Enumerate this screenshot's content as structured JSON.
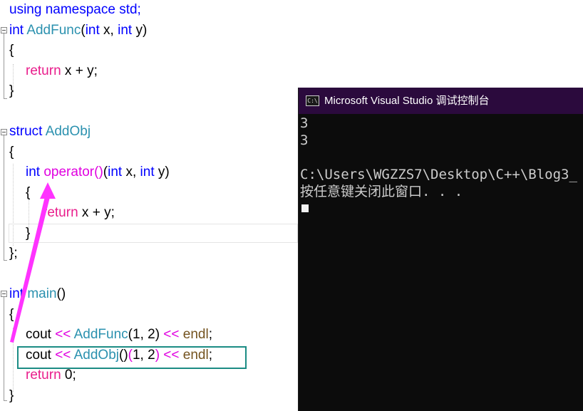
{
  "colors": {
    "keyword": "#0000ff",
    "type_name": "#2b91af",
    "function_name": "#74531f",
    "control_keyword": "#e91e8c",
    "operator_func": "#e000e0",
    "annotation_magenta": "#ff33ff",
    "highlight_box": "#1b8c84",
    "console_titlebar": "#2b0a3d",
    "console_background": "#0c0c0c",
    "console_text": "#cccccc"
  },
  "code": {
    "lines": [
      [
        {
          "t": "using namespace std;",
          "c": "#0000ff"
        }
      ],
      [
        {
          "t": "int",
          "c": "#0000ff"
        },
        {
          "t": " ",
          "c": "#000000"
        },
        {
          "t": "AddFunc",
          "c": "#2b91af"
        },
        {
          "t": "(",
          "c": "#000000"
        },
        {
          "t": "int",
          "c": "#0000ff"
        },
        {
          "t": " x, ",
          "c": "#000000"
        },
        {
          "t": "int",
          "c": "#0000ff"
        },
        {
          "t": " y)",
          "c": "#000000"
        }
      ],
      [
        {
          "t": "{",
          "c": "#000000"
        }
      ],
      [
        {
          "t": "return",
          "c": "#e91e8c"
        },
        {
          "t": " x + y;",
          "c": "#000000"
        }
      ],
      [
        {
          "t": "}",
          "c": "#000000"
        }
      ],
      [],
      [
        {
          "t": "struct",
          "c": "#0000ff"
        },
        {
          "t": " ",
          "c": "#000000"
        },
        {
          "t": "AddObj",
          "c": "#2b91af"
        }
      ],
      [
        {
          "t": "{",
          "c": "#000000"
        }
      ],
      [
        {
          "t": "int",
          "c": "#0000ff"
        },
        {
          "t": " ",
          "c": "#000000"
        },
        {
          "t": "operator()",
          "c": "#e000e0"
        },
        {
          "t": "(",
          "c": "#000000"
        },
        {
          "t": "int",
          "c": "#0000ff"
        },
        {
          "t": " x, ",
          "c": "#000000"
        },
        {
          "t": "int",
          "c": "#0000ff"
        },
        {
          "t": " y)",
          "c": "#000000"
        }
      ],
      [
        {
          "t": "{",
          "c": "#000000"
        }
      ],
      [
        {
          "t": "return",
          "c": "#e91e8c"
        },
        {
          "t": " x + y;",
          "c": "#000000"
        }
      ],
      [
        {
          "t": "}",
          "c": "#000000"
        }
      ],
      [
        {
          "t": "};",
          "c": "#000000"
        }
      ],
      [],
      [
        {
          "t": "int",
          "c": "#0000ff"
        },
        {
          "t": " ",
          "c": "#000000"
        },
        {
          "t": "main",
          "c": "#2b91af"
        },
        {
          "t": "()",
          "c": "#000000"
        }
      ],
      [
        {
          "t": "{",
          "c": "#000000"
        }
      ],
      [
        {
          "t": "cout",
          "c": "#000000"
        },
        {
          "t": " << ",
          "c": "#e000e0"
        },
        {
          "t": "AddFunc",
          "c": "#2b91af"
        },
        {
          "t": "(1, 2)",
          "c": "#000000"
        },
        {
          "t": " << ",
          "c": "#e000e0"
        },
        {
          "t": "endl",
          "c": "#74531f"
        },
        {
          "t": ";",
          "c": "#000000"
        }
      ],
      [
        {
          "t": "cout",
          "c": "#000000"
        },
        {
          "t": " << ",
          "c": "#e000e0"
        },
        {
          "t": "AddObj",
          "c": "#2b91af"
        },
        {
          "t": "()",
          "c": "#000000"
        },
        {
          "t": "(",
          "c": "#e000e0"
        },
        {
          "t": "1, 2",
          "c": "#000000"
        },
        {
          "t": ")",
          "c": "#e000e0"
        },
        {
          "t": " << ",
          "c": "#e000e0"
        },
        {
          "t": "endl",
          "c": "#74531f"
        },
        {
          "t": ";",
          "c": "#000000"
        }
      ],
      [
        {
          "t": "return",
          "c": "#e91e8c"
        },
        {
          "t": " 0;",
          "c": "#000000"
        }
      ],
      [
        {
          "t": "}",
          "c": "#000000"
        }
      ]
    ]
  },
  "console": {
    "icon_label": "C:\\",
    "title": "Microsoft Visual Studio 调试控制台",
    "output_lines": [
      "3",
      "3",
      "",
      "C:\\Users\\WGZZS7\\Desktop\\C++\\Blog3_",
      "按任意键关闭此窗口. . ."
    ]
  }
}
